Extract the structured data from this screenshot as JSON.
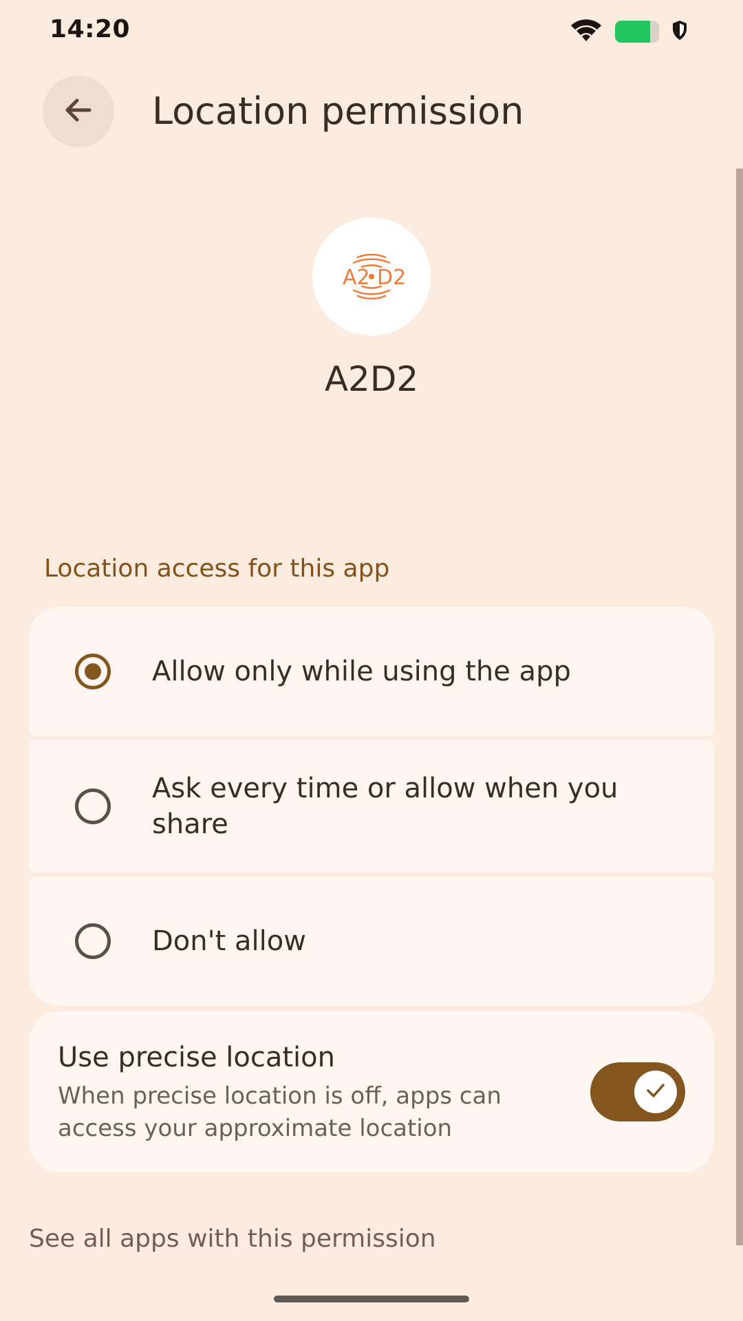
{
  "status_bar": {
    "time": "14:20",
    "battery_color": "#22c55e"
  },
  "app_bar": {
    "title": "Location permission",
    "back_icon": "arrow-left-icon"
  },
  "app": {
    "name": "A2D2",
    "logo_text_left": "A2",
    "logo_text_right": "D2",
    "logo_color": "#f07c3a"
  },
  "section": {
    "header": "Location access for this app",
    "header_color": "#84511a"
  },
  "options": [
    {
      "label": "Allow only while using the app",
      "selected": true
    },
    {
      "label": "Ask every time or allow when you share",
      "selected": false
    },
    {
      "label": "Don't allow",
      "selected": false
    }
  ],
  "precise_location": {
    "title": "Use precise location",
    "description": "When precise location is off, apps can access your approximate location",
    "enabled": true
  },
  "footer": {
    "see_all_link": "See all apps with this permission"
  },
  "colors": {
    "background": "#fcebdf",
    "card": "#fff5f1",
    "accent": "#84561f"
  }
}
